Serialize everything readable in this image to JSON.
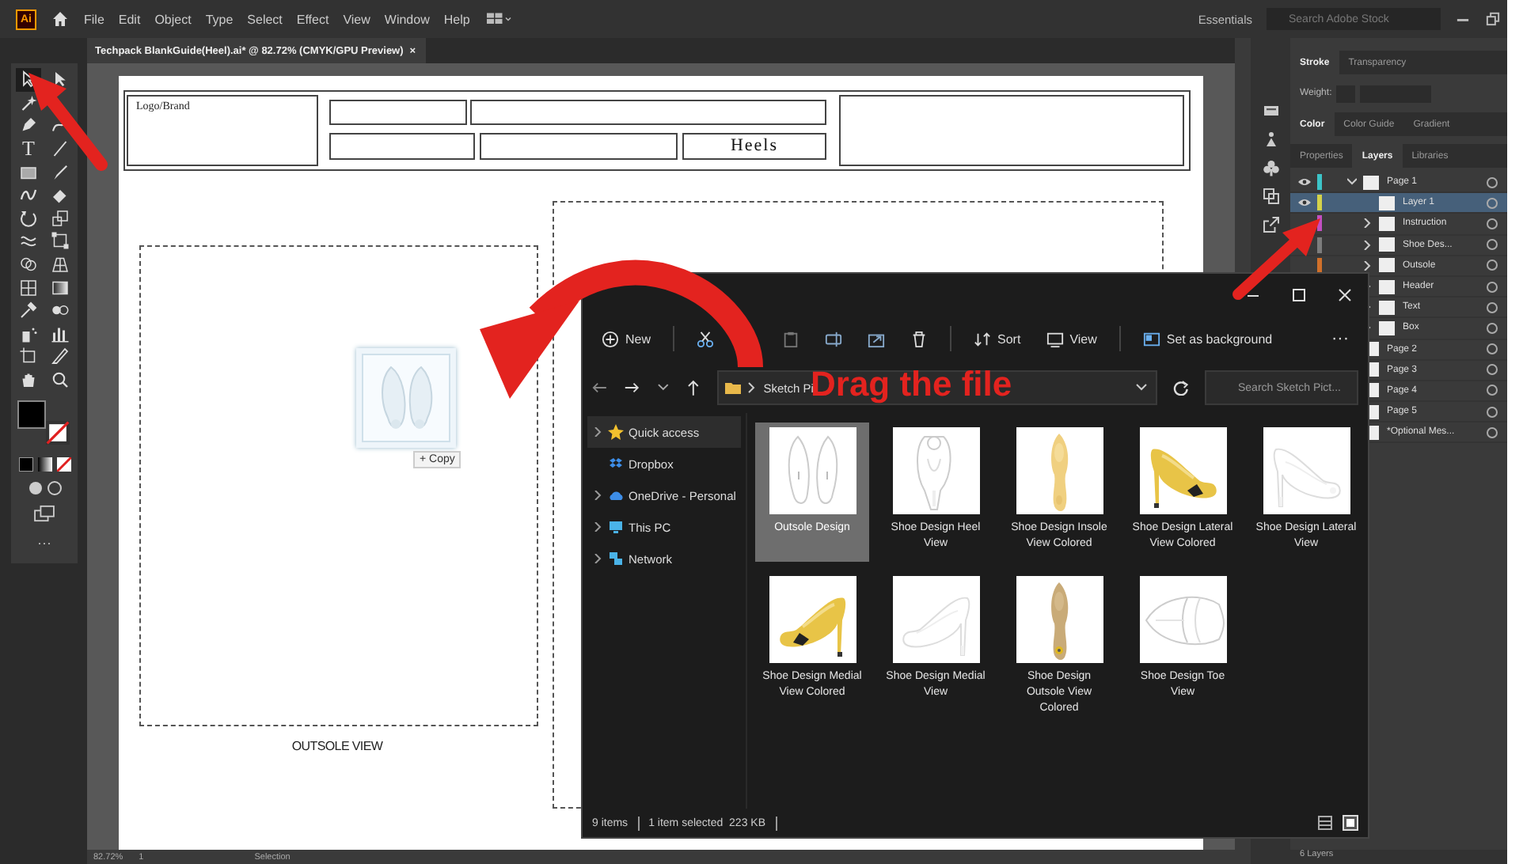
{
  "menubar": {
    "app_logo": "Ai",
    "menus": [
      "File",
      "Edit",
      "Object",
      "Type",
      "Select",
      "Effect",
      "View",
      "Window",
      "Help"
    ],
    "workspace": "Essentials",
    "search": {
      "placeholder": "Search Adobe Stock"
    }
  },
  "document_tab": {
    "title": "Techpack BlankGuide(Heel).ai* @ 82.72% (CMYK/GPU Preview)",
    "close": "×"
  },
  "tools": [
    {
      "kind": "select",
      "selected": true
    },
    {
      "kind": "direct",
      "selected": false
    },
    {
      "kind": "wand",
      "selected": false
    },
    {
      "kind": "pen",
      "selected": false
    },
    {
      "kind": "curvature",
      "selected": false
    },
    {
      "kind": "type",
      "glyph": "T",
      "selected": false
    },
    {
      "kind": "line",
      "selected": false
    },
    {
      "kind": "rect",
      "selected": false
    },
    {
      "kind": "brush",
      "selected": false
    },
    {
      "kind": "shaper",
      "selected": false
    },
    {
      "kind": "eraser",
      "selected": false
    },
    {
      "kind": "rotate",
      "selected": false
    },
    {
      "kind": "scale",
      "selected": false
    },
    {
      "kind": "warp",
      "selected": false
    },
    {
      "kind": "transform",
      "selected": false
    },
    {
      "kind": "builder",
      "selected": false
    },
    {
      "kind": "perspective",
      "selected": false
    },
    {
      "kind": "mesh",
      "selected": false
    },
    {
      "kind": "gradient",
      "selected": false
    },
    {
      "kind": "eyedropper",
      "selected": false
    },
    {
      "kind": "blend",
      "selected": false
    },
    {
      "kind": "symbol",
      "selected": false
    },
    {
      "kind": "graph",
      "selected": false
    },
    {
      "kind": "artboard",
      "selected": false
    },
    {
      "kind": "slice",
      "selected": false
    },
    {
      "kind": "hand",
      "selected": false
    },
    {
      "kind": "zoom",
      "selected": false
    }
  ],
  "toolbar_more": "···",
  "artboard": {
    "logo_label": "Logo/Brand",
    "title_cell": "Heels",
    "caption": "OUTSOLE VIEW",
    "drag_badge": "+ Copy"
  },
  "status_bar": {
    "zoom": "82.72%",
    "page": "1",
    "tool": "Selection"
  },
  "panels": {
    "stroke_tabs": [
      {
        "label": "Stroke",
        "selected": true
      },
      {
        "label": "Transparency",
        "selected": false
      }
    ],
    "weight_label": "Weight:",
    "color_tabs": [
      {
        "label": "Color",
        "selected": true
      },
      {
        "label": "Color Guide",
        "selected": false
      },
      {
        "label": "Gradient",
        "selected": false
      }
    ],
    "tabs": [
      {
        "label": "Properties",
        "selected": false
      },
      {
        "label": "Layers",
        "selected": true
      },
      {
        "label": "Libraries",
        "selected": false
      }
    ],
    "layers": [
      {
        "name": "Page 1",
        "kind": "group",
        "expanded": true,
        "visible": true,
        "selected": false,
        "color": "#3cc4c8",
        "children": [
          {
            "name": "Layer 1",
            "kind": "layer",
            "visible": true,
            "selected": true,
            "color": "#d4d24a"
          },
          {
            "name": "Instruction",
            "kind": "group",
            "expanded": false,
            "visible": false,
            "selected": false,
            "color": "#c24fc2"
          },
          {
            "name": "Shoe Des...",
            "kind": "group",
            "expanded": false,
            "visible": false,
            "selected": false,
            "color": "#7d7d7d"
          },
          {
            "name": "Outsole",
            "kind": "group",
            "expanded": false,
            "visible": false,
            "selected": false,
            "color": "#d0702a"
          },
          {
            "name": "Header",
            "kind": "group",
            "expanded": false,
            "selected": false
          },
          {
            "name": "Text",
            "kind": "group",
            "expanded": false,
            "selected": false
          },
          {
            "name": "Box",
            "kind": "group",
            "expanded": false,
            "selected": false
          }
        ]
      },
      {
        "name": "Page 2",
        "kind": "layer",
        "selected": false
      },
      {
        "name": "Page 3",
        "kind": "layer",
        "selected": false
      },
      {
        "name": "Page 4",
        "kind": "layer",
        "selected": false
      },
      {
        "name": "Page 5",
        "kind": "layer",
        "selected": false
      },
      {
        "name": "*Optional Mes...",
        "kind": "layer",
        "selected": false
      }
    ],
    "footer": "6 Layers"
  },
  "explorer": {
    "toolbar": {
      "new": "New",
      "sort": "Sort",
      "view": "View",
      "background": "Set as background",
      "more": "···"
    },
    "address": {
      "path": "Sketch Pi"
    },
    "search": {
      "placeholder": "Search Sketch Pict..."
    },
    "nav": [
      {
        "label": "Quick access",
        "kind": "tree",
        "expanded": false,
        "selected": true
      },
      {
        "label": "Dropbox",
        "kind": "leaf",
        "selected": false
      },
      {
        "label": "OneDrive - Personal",
        "kind": "tree",
        "expanded": false,
        "selected": false
      },
      {
        "label": "This PC",
        "kind": "tree",
        "expanded": false,
        "selected": false
      },
      {
        "label": "Network",
        "kind": "tree",
        "expanded": false,
        "selected": false
      }
    ],
    "files": [
      {
        "name": "Outsole Design",
        "selected": true
      },
      {
        "name": "Shoe Design Heel View",
        "selected": false
      },
      {
        "name": "Shoe Design Insole View Colored",
        "selected": false
      },
      {
        "name": "Shoe Design Lateral View Colored",
        "selected": false
      },
      {
        "name": "Shoe Design Lateral View",
        "selected": false
      },
      {
        "name": "Shoe Design Medial View Colored",
        "selected": false
      },
      {
        "name": "Shoe Design Medial View",
        "selected": false
      },
      {
        "name": "Shoe Design Outsole View Colored",
        "selected": false
      },
      {
        "name": "Shoe Design Toe View",
        "selected": false
      }
    ],
    "status": {
      "count": "9 items",
      "selection": "1 item selected  223 KB"
    }
  },
  "annotation": {
    "text": "Drag the file"
  }
}
